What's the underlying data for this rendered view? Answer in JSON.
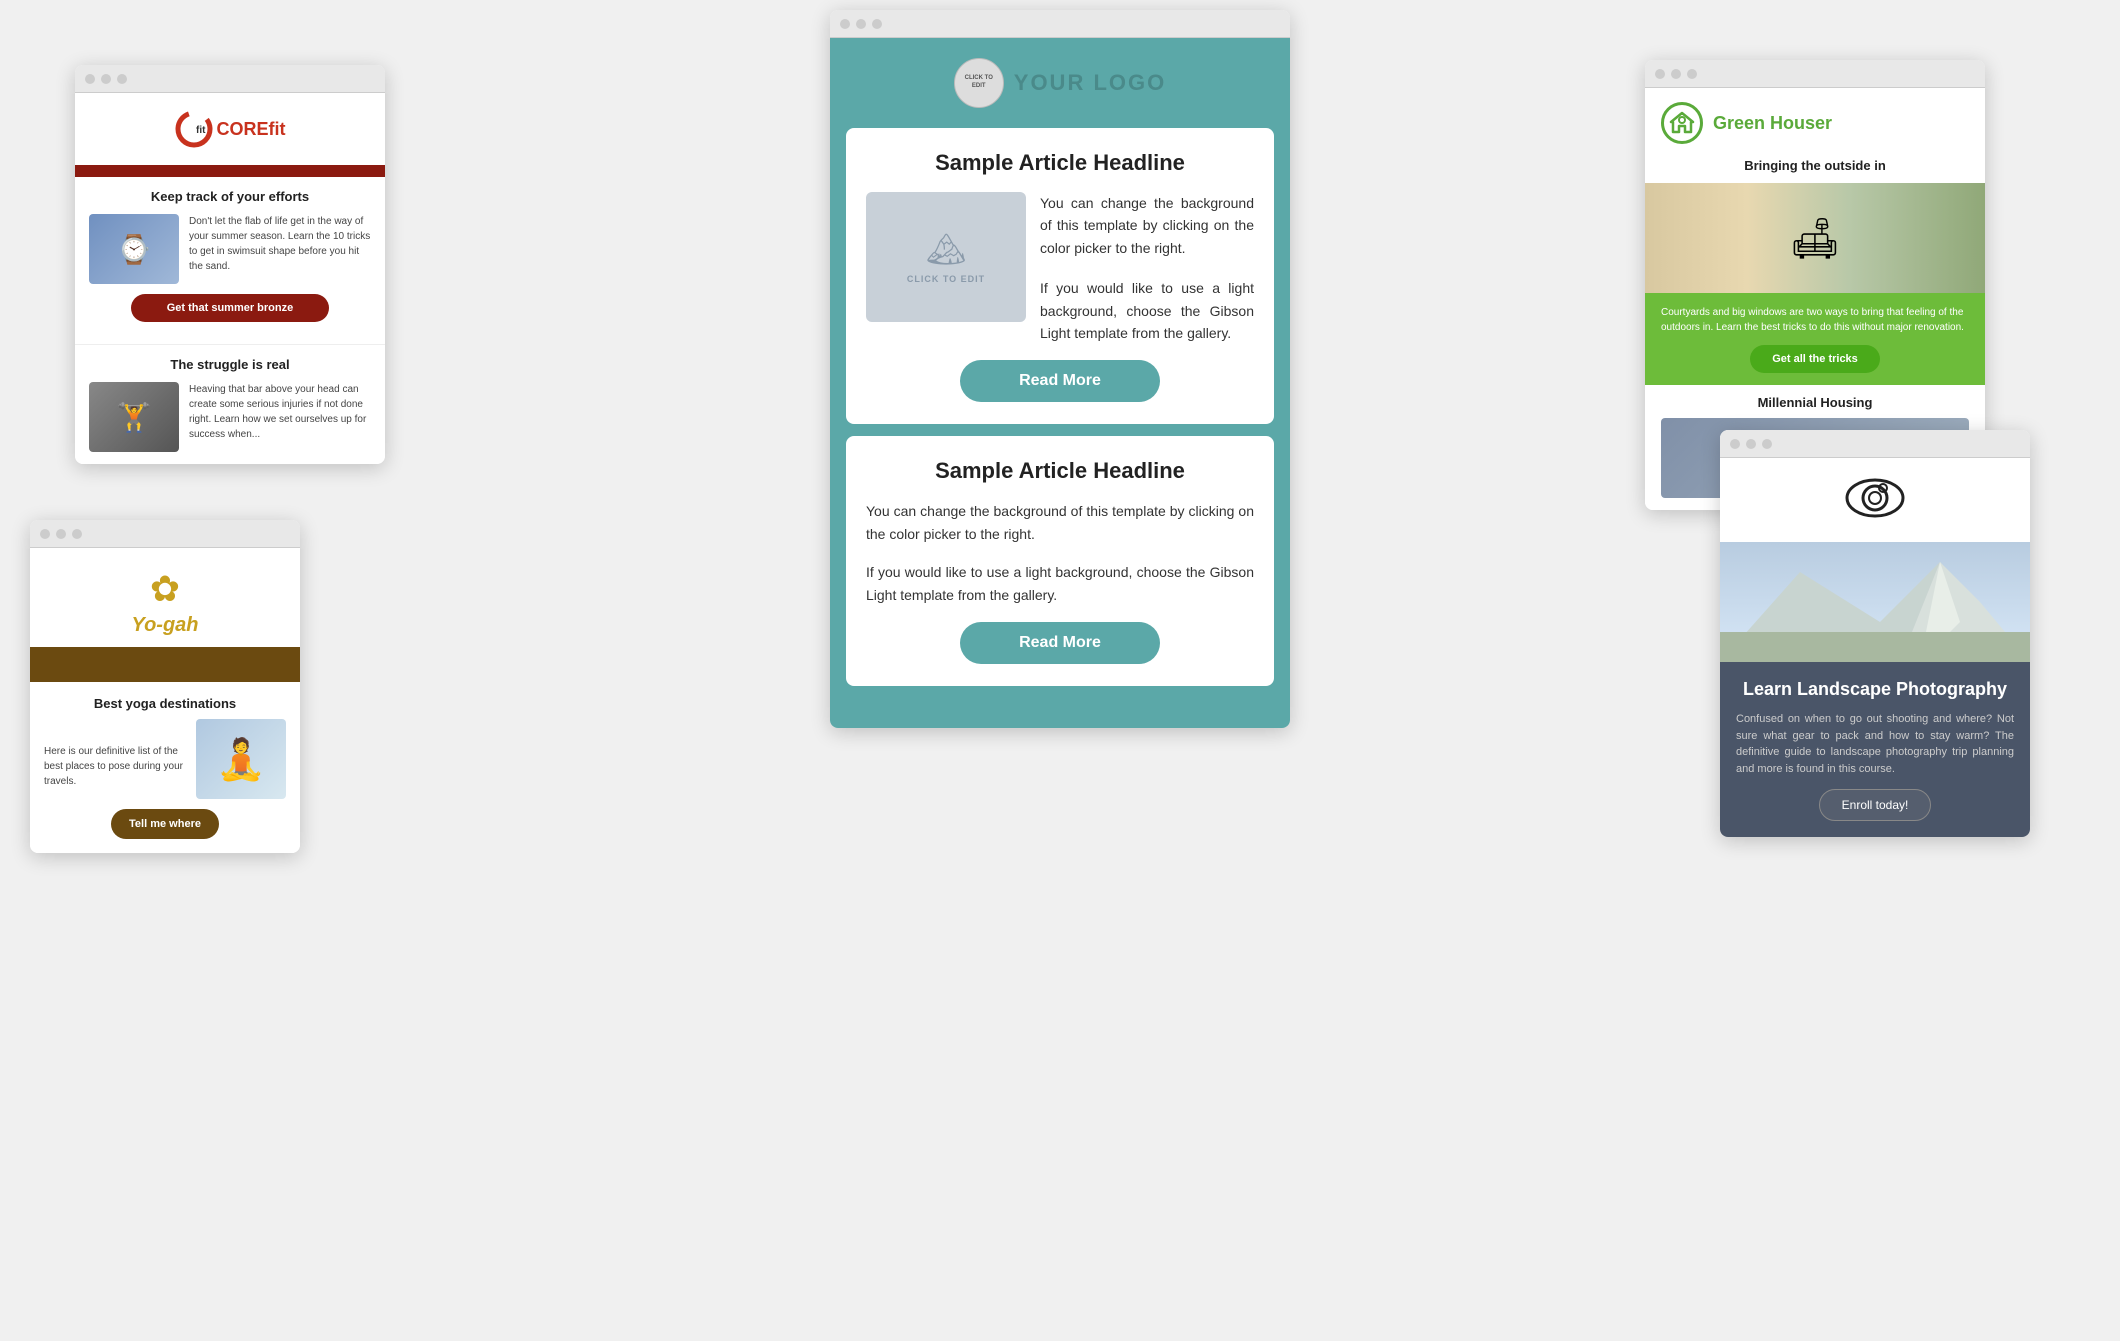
{
  "main": {
    "logo_placeholder": "CLICK TO EDIT",
    "logo_text": "YOUR LOGO",
    "article1": {
      "headline": "Sample Article Headline",
      "image_text": "CLICK TO EDIT",
      "body1": "You can change the background of this template by clicking on the color picker to the right.",
      "body2": "If you would like to use a light background, choose the Gibson Light template from the gallery.",
      "read_more": "Read More"
    },
    "article2": {
      "headline": "Sample Article Headline",
      "body1": "You can change the background of this template by clicking on the color picker to the right.",
      "body2": "If you would like to use a light background, choose the Gibson Light template from the gallery.",
      "read_more": "Read More"
    }
  },
  "corefit": {
    "brand": "COREfit",
    "section1_title": "Keep track of your efforts",
    "section1_text": "Don't let the flab of life get in the way of your summer season. Learn the 10 tricks to get in swimsuit shape before you hit the sand.",
    "section1_btn": "Get that summer bronze",
    "section2_title": "The struggle is real",
    "section2_text": "Heaving that bar above your head can create some serious injuries if not done right. Learn how we set ourselves up for success when...",
    "section2_btn": ""
  },
  "yogah": {
    "brand": "Yo-gah",
    "section_title": "Best yoga destinations",
    "section_text": "Here is our definitive list of the best places to pose during your travels.",
    "btn": "Tell me where"
  },
  "greenhouser": {
    "brand": "Green Houser",
    "tagline": "Bringing the outside in",
    "section1_text": "Courtyards and big windows are two ways to bring that feeling of the outdoors in. Learn the best tricks to do this without major renovation.",
    "section1_btn": "Get all the tricks",
    "section2_title": "Millennial Housing"
  },
  "camera": {
    "headline": "Learn Landscape Photography",
    "text": "Confused on when to go out shooting and where? Not sure what gear to pack and how to stay warm? The definitive guide to landscape photography trip planning and more is found in this course.",
    "btn": "Enroll today!"
  },
  "colors": {
    "teal": "#5ba8a8",
    "dark_red": "#8b1a10",
    "green": "#5aaa3a",
    "brown": "#6b4a10",
    "dark_gray": "#4a5568"
  }
}
